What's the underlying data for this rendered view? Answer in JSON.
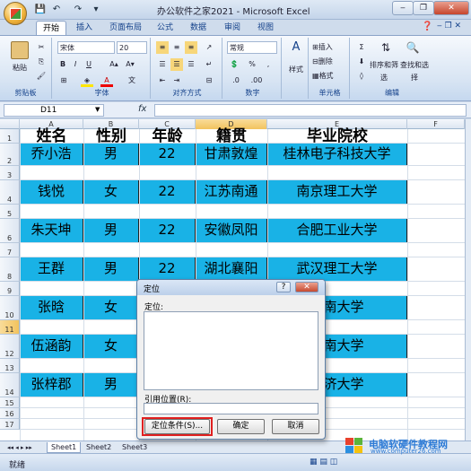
{
  "window": {
    "title": "办公软件之家2021 - Microsoft Excel"
  },
  "tabs": [
    "开始",
    "插入",
    "页面布局",
    "公式",
    "数据",
    "审阅",
    "视图"
  ],
  "ribbon": {
    "paste_label": "粘贴",
    "font_name": "宋体",
    "font_size": "20",
    "number_format": "常规",
    "style_label": "样式",
    "insert_label": "插入",
    "delete_label": "删除",
    "format_label": "格式",
    "sort_label": "排序和筛选",
    "find_label": "查找和选择",
    "groups": [
      "剪贴板",
      "字体",
      "对齐方式",
      "数字",
      "单元格",
      "编辑"
    ]
  },
  "formula_bar": {
    "name_box": "D11",
    "fx": "fx",
    "value": ""
  },
  "columns": [
    "A",
    "B",
    "C",
    "D",
    "E",
    "F"
  ],
  "rows": [
    "1",
    "2",
    "3",
    "4",
    "5",
    "6",
    "7",
    "8",
    "9",
    "10",
    "11",
    "12",
    "13",
    "14",
    "15",
    "16",
    "17"
  ],
  "table": {
    "headers": [
      "姓名",
      "性别",
      "年龄",
      "籍贯",
      "毕业院校"
    ],
    "records": [
      [
        "乔小浩",
        "男",
        "22",
        "甘肃敦煌",
        "桂林电子科技大学"
      ],
      [
        "钱悦",
        "女",
        "22",
        "江苏南通",
        "南京理工大学"
      ],
      [
        "朱天坤",
        "男",
        "22",
        "安徽凤阳",
        "合肥工业大学"
      ],
      [
        "王群",
        "男",
        "22",
        "湖北襄阳",
        "武汉理工大学"
      ],
      [
        "张晗",
        "女",
        "",
        "",
        "江南大学"
      ],
      [
        "伍涵韵",
        "女",
        "",
        "",
        "东南大学"
      ],
      [
        "张梓郡",
        "男",
        "",
        "",
        "同济大学"
      ]
    ]
  },
  "sheet_tabs": [
    "Sheet1",
    "Sheet2",
    "Sheet3"
  ],
  "status": {
    "ready": "就绪"
  },
  "dialog": {
    "title": "定位",
    "list_label": "定位:",
    "ref_label": "引用位置(R):",
    "ref_value": "",
    "special_button": "定位条件(S)...",
    "ok_button": "确定",
    "cancel_button": "取消"
  },
  "watermark": {
    "line1": "电脑软硬件教程网",
    "line2": "www.computer26.com"
  },
  "colors": {
    "cell_fill": "#19b2e6",
    "ribbon": "#d7e4f3",
    "highlight": "#e02020"
  }
}
